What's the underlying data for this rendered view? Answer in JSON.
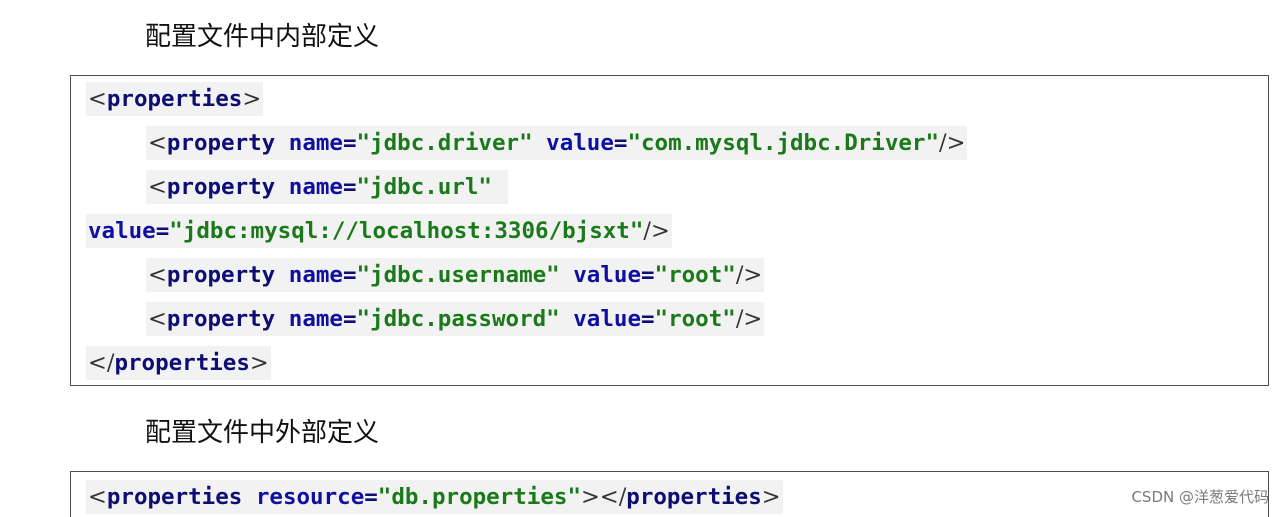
{
  "headings": {
    "internal": "配置文件中内部定义",
    "external": "配置文件中外部定义"
  },
  "code_internal": {
    "line1": {
      "lt": "<",
      "tag": "properties",
      "gt": ">"
    },
    "line2": {
      "lt": "<",
      "tag": "property",
      "attr1": "name",
      "eq1": "=",
      "val1": "\"jdbc.driver\"",
      "attr2": "value",
      "eq2": "=",
      "val2": "\"com.mysql.jdbc.Driver\"",
      "end": "/>"
    },
    "line3": {
      "lt": "<",
      "tag": "property",
      "attr1": "name",
      "eq1": "=",
      "val1": "\"jdbc.url\""
    },
    "line4": {
      "attr": "value",
      "eq": "=",
      "val": "\"jdbc:mysql://localhost:3306/bjsxt\"",
      "end": "/>"
    },
    "line5": {
      "lt": "<",
      "tag": "property",
      "attr1": "name",
      "eq1": "=",
      "val1": "\"jdbc.username\"",
      "attr2": "value",
      "eq2": "=",
      "val2": "\"root\"",
      "end": "/>"
    },
    "line6": {
      "lt": "<",
      "tag": "property",
      "attr1": "name",
      "eq1": "=",
      "val1": "\"jdbc.password\"",
      "attr2": "value",
      "eq2": "=",
      "val2": "\"root\"",
      "end": "/>"
    },
    "line7": {
      "lt": "</",
      "tag": "properties",
      "gt": ">"
    }
  },
  "code_external": {
    "line1": {
      "lt": "<",
      "tag": "properties",
      "attr": "resource",
      "eq": "=",
      "val": "\"db.properties\"",
      "mid": "></",
      "tag2": "properties",
      "gt": ">"
    }
  },
  "watermark": "CSDN @洋葱爱代码"
}
